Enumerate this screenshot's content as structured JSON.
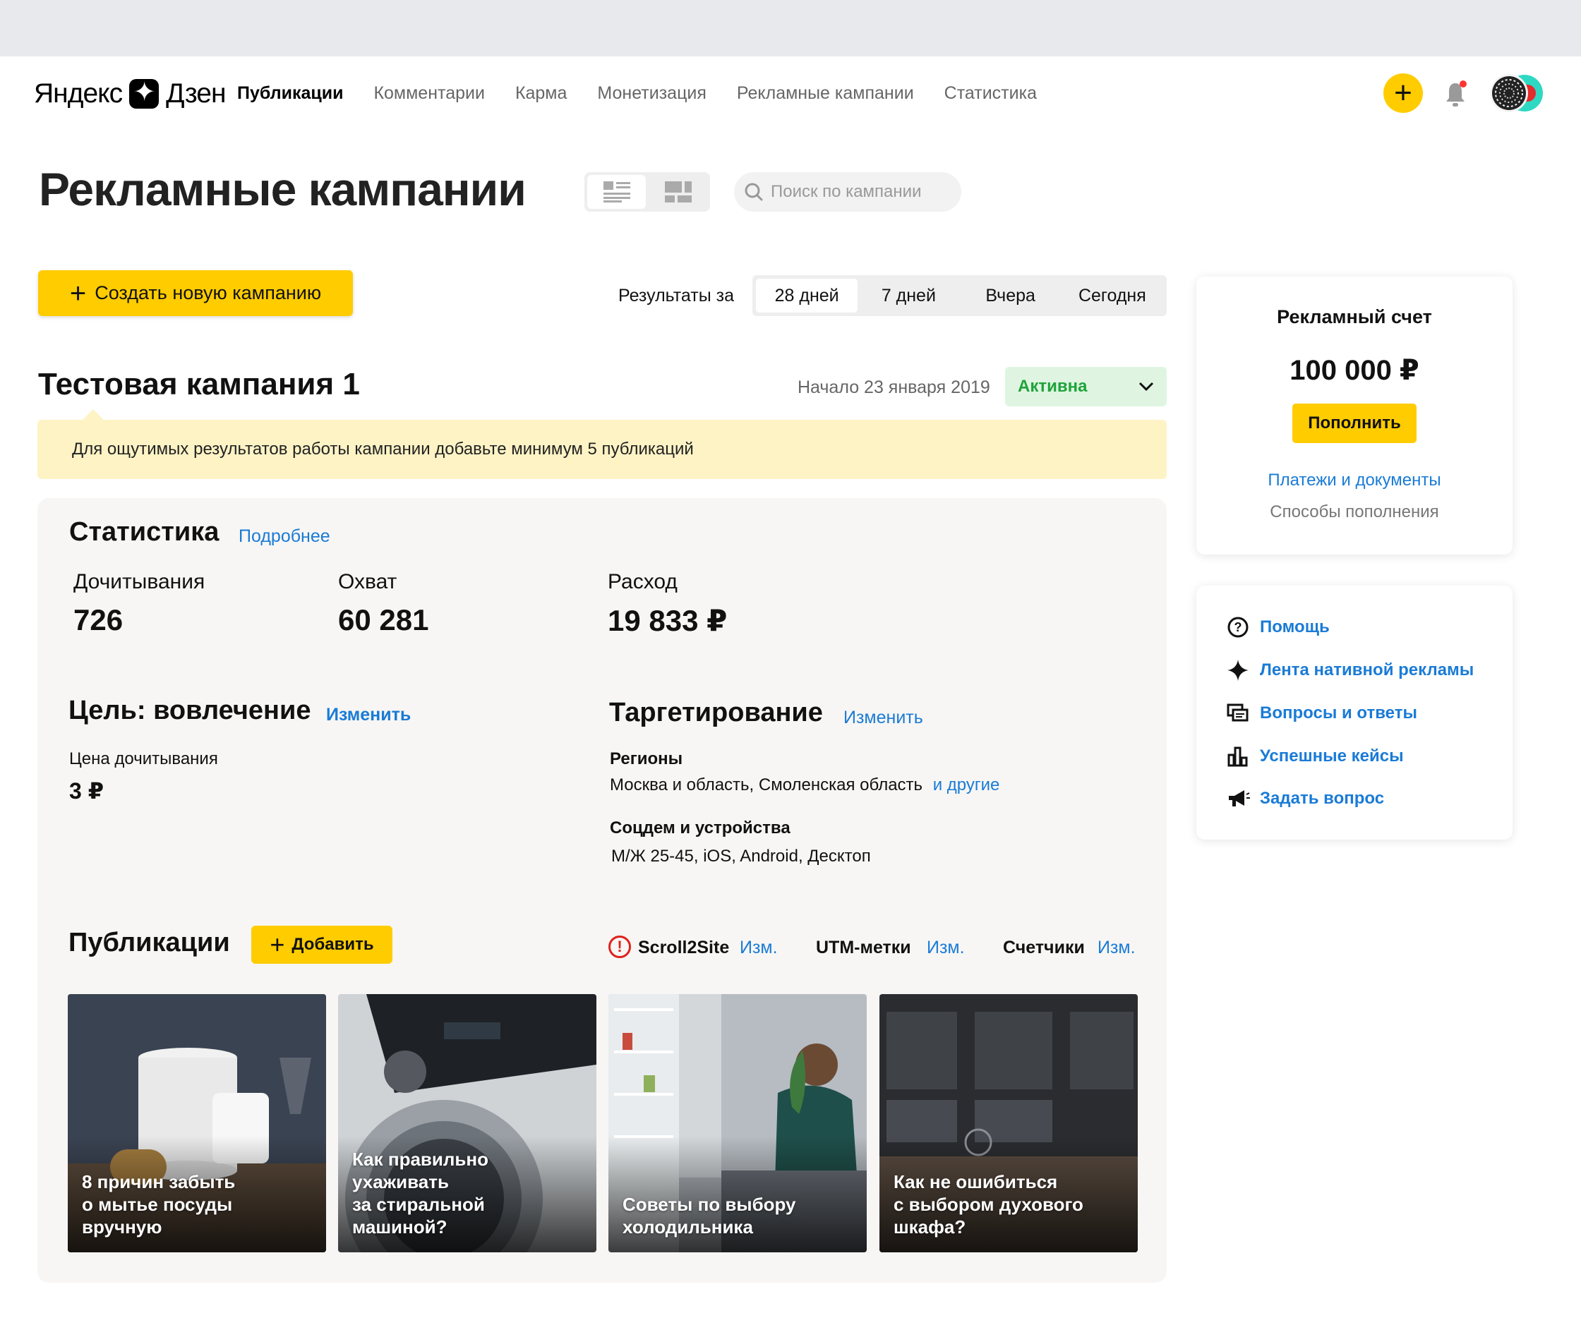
{
  "header": {
    "logo_left": "Яндекс",
    "logo_right": "Дзен",
    "nav": [
      {
        "label": "Публикации",
        "active": true
      },
      {
        "label": "Комментарии"
      },
      {
        "label": "Карма"
      },
      {
        "label": "Монетизация"
      },
      {
        "label": "Рекламные кампании"
      },
      {
        "label": "Статистика"
      }
    ],
    "plus_icon": "+"
  },
  "page": {
    "title": "Рекламные кампании",
    "search_placeholder": "Поиск по кампании"
  },
  "toolbar": {
    "create_icon": "+",
    "create_label": "Создать новую кампанию",
    "period_label": "Результаты за",
    "periods": [
      "28 дней",
      "7 дней",
      "Вчера",
      "Сегодня"
    ],
    "period_selected": "28 дней"
  },
  "campaign": {
    "title": "Тестовая кампания 1",
    "start": "Начало 23 января 2019",
    "status": "Активна",
    "status_chevron": "⌄",
    "notice": "Для ощутимых результатов работы кампании добавьте минимум 5 публикаций"
  },
  "stats": {
    "title": "Статистика",
    "more_link": "Подробнее",
    "items": [
      {
        "label": "Дочитывания",
        "value": "726"
      },
      {
        "label": "Охват",
        "value": "60 281"
      },
      {
        "label": "Расход",
        "value": "19 833 ₽"
      }
    ]
  },
  "goal": {
    "title": "Цель: вовлечение",
    "change": "Изменить",
    "price_label": "Цена дочитывания",
    "price_value": "3 ₽"
  },
  "targeting": {
    "title": "Таргетирование",
    "change": "Изменить",
    "regions_label": "Регионы",
    "regions_value": "Москва и область, Смоленская область",
    "regions_more": "и другие",
    "socdem_label": "Соцдем и устройства",
    "socdem_value": "М/Ж 25-45, iOS, Android, Десктоп"
  },
  "publications": {
    "title": "Публикации",
    "add_icon": "+",
    "add_label": "Добавить",
    "warn_icon": "!",
    "scroll2site": "Scroll2Site",
    "utm": "UTM-метки",
    "counters": "Счетчики",
    "edit": "Изм.",
    "tiles": [
      {
        "caption_1": "8 причин забыть",
        "caption_2": "о мытье посуды вручную",
        "caption_3": ""
      },
      {
        "caption_1": "Как правильно",
        "caption_2": "ухаживать",
        "caption_3": "за стиральной машиной?"
      },
      {
        "caption_1": "Советы по выбору",
        "caption_2": "холодильника",
        "caption_3": ""
      },
      {
        "caption_1": "Как не ошибиться",
        "caption_2": "с выбором духового",
        "caption_3": "шкафа?"
      }
    ]
  },
  "account": {
    "title": "Рекламный счет",
    "sum": "100 000 ₽",
    "topup": "Пополнить",
    "payments_link": "Платежи и документы",
    "methods": "Способы пополнения"
  },
  "help": {
    "items": [
      {
        "label": "Помощь",
        "icon": "question-circle-icon",
        "glyph": "?"
      },
      {
        "label": "Лента нативной рекламы",
        "icon": "sparkle-icon",
        "glyph": "✦"
      },
      {
        "label": "Вопросы и ответы",
        "icon": "chat-bubbles-icon",
        "glyph": "▤"
      },
      {
        "label": "Успешные кейсы",
        "icon": "bar-chart-icon",
        "glyph": "▥"
      },
      {
        "label": "Задать вопрос",
        "icon": "megaphone-icon",
        "glyph": "📢"
      }
    ]
  },
  "colors": {
    "accent": "#ffcc00",
    "link": "#1a7bd6",
    "status_green": "#1fa33a",
    "notice_bg": "#fdf3c5",
    "warn_red": "#e0201b"
  }
}
